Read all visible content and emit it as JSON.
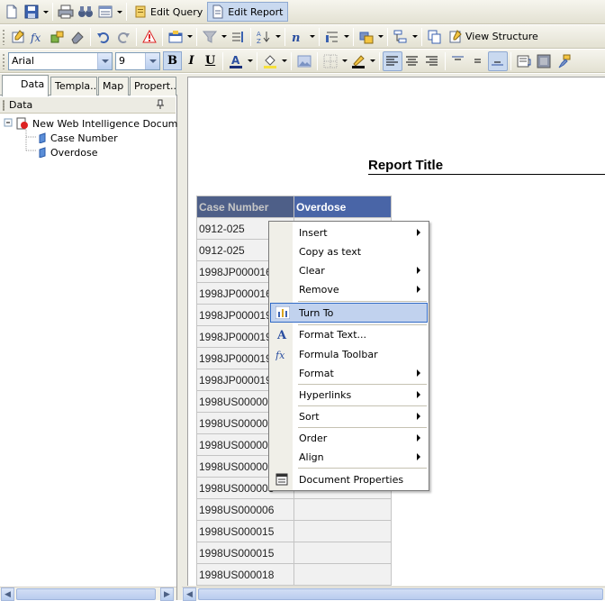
{
  "toolbar1": {
    "edit_query_label": "Edit Query",
    "edit_report_label": "Edit Report"
  },
  "toolbar2": {
    "view_structure_label": "View Structure"
  },
  "format_bar": {
    "font_family": "Arial",
    "font_size": "9"
  },
  "left_panel": {
    "tabs": [
      "Data",
      "Templa..",
      "Map",
      "Propert.."
    ],
    "data_header": "Data",
    "tree": {
      "root": "New Web Intelligence Document",
      "items": [
        "Case Number",
        "Overdose"
      ]
    }
  },
  "report": {
    "title": "Report Title",
    "columns": [
      "Case Number",
      "Overdose"
    ],
    "rows": [
      [
        "0912-025",
        ""
      ],
      [
        "0912-025",
        ""
      ],
      [
        "1998JP000016",
        ""
      ],
      [
        "1998JP000016",
        ""
      ],
      [
        "1998JP000019",
        ""
      ],
      [
        "1998JP000019",
        ""
      ],
      [
        "1998JP000019",
        ""
      ],
      [
        "1998JP000019",
        ""
      ],
      [
        "1998US000003",
        ""
      ],
      [
        "1998US000003",
        ""
      ],
      [
        "1998US000003",
        ""
      ],
      [
        "1998US000003",
        ""
      ],
      [
        "1998US000003",
        ""
      ],
      [
        "1998US000006",
        ""
      ],
      [
        "1998US000015",
        ""
      ],
      [
        "1998US000015",
        ""
      ],
      [
        "1998US000018",
        ""
      ]
    ]
  },
  "context_menu": {
    "items": [
      {
        "label": "Insert",
        "submenu": true
      },
      {
        "label": "Copy as text",
        "submenu": false
      },
      {
        "label": "Clear",
        "submenu": true
      },
      {
        "label": "Remove",
        "submenu": true
      },
      {
        "label": "Turn To",
        "submenu": false,
        "highlighted": true
      },
      {
        "label": "Format Text...",
        "submenu": false
      },
      {
        "label": "Formula Toolbar",
        "submenu": false
      },
      {
        "label": "Format",
        "submenu": true
      },
      {
        "label": "Hyperlinks",
        "submenu": true
      },
      {
        "label": "Sort",
        "submenu": true
      },
      {
        "label": "Order",
        "submenu": true
      },
      {
        "label": "Align",
        "submenu": true
      },
      {
        "label": "Document Properties",
        "submenu": false
      }
    ]
  },
  "colors": {
    "header_dark": "#4e5f88",
    "header_blue": "#4965a7",
    "highlight": "#c1d2ee"
  }
}
